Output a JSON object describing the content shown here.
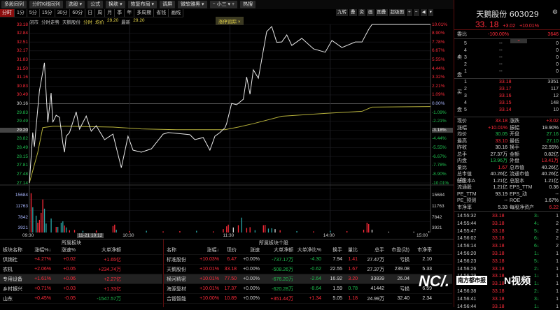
{
  "toolbar": {
    "buttons": [
      "多股同列",
      "分时K线同列",
      "选股 ▾",
      "公式",
      "换肤 ▾",
      "恢复布局 ▾",
      "调屏",
      "微软雅黑 ▾",
      "−  小三 ▾  +",
      "热搜"
    ]
  },
  "period_tabs": [
    "分时",
    "1分",
    "5分",
    "15分",
    "30分",
    "60分",
    "日",
    "周",
    "月",
    "季",
    "年",
    "多周期",
    "省钱",
    "画线"
  ],
  "chart_info": {
    "status": "闭市",
    "mode": "分时走势",
    "name": "天鹅股份",
    "type": "分时",
    "avg_label": "均价",
    "avg_value": "29.20",
    "last_label": "最新",
    "last_value": "29.20",
    "tag": "涨停追踪",
    "tag_close": "×",
    "right_tools": [
      "九转",
      "叠",
      "资",
      "画",
      "图叠",
      "超级图",
      "+",
      "−",
      "◀",
      "▾"
    ]
  },
  "chart_data": {
    "type": "line",
    "title": "天鹅股份 分时走势",
    "prev_close": 30.16,
    "left_ticks": [
      "33.18",
      "32.84",
      "32.51",
      "32.17",
      "31.83",
      "31.50",
      "31.16",
      "30.83",
      "30.49",
      "30.16",
      "29.83",
      "29.49",
      "29.20",
      "28.82",
      "28.49",
      "28.15",
      "27.81",
      "27.48",
      "27.14"
    ],
    "right_ticks": [
      "10.01%",
      "8.90%",
      "7.78%",
      "6.67%",
      "5.55%",
      "4.44%",
      "3.32%",
      "2.21%",
      "1.09%",
      "0.00%",
      "-1.09%",
      "-2.21%",
      "-3.18%",
      "-4.44%",
      "-5.55%",
      "-6.67%",
      "-7.78%",
      "-8.90%",
      "-10.01%"
    ],
    "highlight_index": 12,
    "ylim": [
      27.14,
      33.18
    ],
    "vol_ticks": [
      "15684",
      "11763",
      "7842",
      "3921"
    ],
    "vol_max": 15684,
    "time_ticks": [
      "09:30",
      "10:30",
      "11:30",
      "14:00",
      "15:00"
    ],
    "crosshair_time": "11-21 10:12",
    "price": [
      [
        0,
        27.14
      ],
      [
        2,
        29.06
      ],
      [
        3,
        28.52
      ],
      [
        4,
        29.27
      ],
      [
        6,
        30.65
      ],
      [
        9,
        31.72
      ],
      [
        11,
        29.45
      ],
      [
        13,
        30.57
      ],
      [
        14,
        29.45
      ],
      [
        16,
        29.72
      ],
      [
        18,
        29.64
      ],
      [
        20,
        28.66
      ],
      [
        21,
        28.31
      ],
      [
        22,
        28.92
      ],
      [
        24,
        29.06
      ],
      [
        28,
        29.85
      ],
      [
        30,
        29.19
      ],
      [
        34,
        29.69
      ],
      [
        37,
        29.11
      ],
      [
        40,
        29.32
      ],
      [
        45,
        28.79
      ],
      [
        50,
        29.0
      ],
      [
        55,
        27.72
      ],
      [
        57,
        28.31
      ],
      [
        59,
        28.92
      ],
      [
        62,
        28.39
      ],
      [
        67,
        28.31
      ],
      [
        73,
        28.44
      ],
      [
        80,
        29.0
      ],
      [
        83,
        29.06
      ],
      [
        96,
        28.98
      ],
      [
        99,
        28.79
      ],
      [
        104,
        28.87
      ],
      [
        108,
        28.39
      ],
      [
        111,
        28.92
      ],
      [
        114,
        29.06
      ],
      [
        117,
        29.24
      ],
      [
        118,
        29.4
      ],
      [
        121,
        30.17
      ],
      [
        124,
        30.12
      ],
      [
        128,
        30.33
      ],
      [
        130,
        31.18
      ],
      [
        132,
        30.52
      ],
      [
        134,
        31.45
      ],
      [
        137,
        31.13
      ],
      [
        142,
        32.91
      ],
      [
        145,
        33.1
      ],
      [
        148,
        32.5
      ],
      [
        151,
        32.51
      ],
      [
        154,
        32.78
      ],
      [
        157,
        32.38
      ],
      [
        163,
        32.65
      ],
      [
        170,
        32.25
      ],
      [
        177,
        32.12
      ],
      [
        181,
        32.57
      ],
      [
        187,
        32.3
      ],
      [
        195,
        32.51
      ],
      [
        199,
        32.51
      ],
      [
        203,
        32.99
      ],
      [
        205,
        33.18
      ],
      [
        240,
        33.18
      ]
    ],
    "avg": [
      [
        0,
        27.14
      ],
      [
        5,
        28.3
      ],
      [
        8,
        29.25
      ],
      [
        14,
        29.3
      ],
      [
        24,
        29.3
      ],
      [
        50,
        29.27
      ],
      [
        67,
        29.2
      ],
      [
        88,
        29.17
      ],
      [
        117,
        29.17
      ],
      [
        125,
        29.27
      ],
      [
        134,
        29.4
      ],
      [
        151,
        29.68
      ],
      [
        177,
        29.79
      ],
      [
        199,
        29.87
      ],
      [
        205,
        30.03
      ],
      [
        240,
        30.05
      ]
    ],
    "volume": [
      [
        1,
        14000,
        "r"
      ],
      [
        2,
        9000,
        "c"
      ],
      [
        4,
        6000,
        "c"
      ],
      [
        5,
        3500,
        "r"
      ],
      [
        6,
        4500,
        "r"
      ],
      [
        7,
        7000,
        "r"
      ],
      [
        8,
        11800,
        "r"
      ],
      [
        9,
        8500,
        "c"
      ],
      [
        10,
        3200,
        "c"
      ],
      [
        13,
        5000,
        "c"
      ],
      [
        16,
        2000,
        "r"
      ],
      [
        17,
        2000,
        "c"
      ],
      [
        19,
        3500,
        "c"
      ],
      [
        20,
        4000,
        "c"
      ],
      [
        21,
        2500,
        "r"
      ],
      [
        22,
        1800,
        "c"
      ],
      [
        24,
        800,
        "r"
      ],
      [
        27,
        900,
        "r"
      ],
      [
        32,
        600,
        "c"
      ],
      [
        40,
        700,
        "r"
      ],
      [
        50,
        2300,
        "r"
      ],
      [
        51,
        2800,
        "r"
      ],
      [
        52,
        1000,
        "c"
      ],
      [
        60,
        500,
        "r"
      ],
      [
        70,
        600,
        "c"
      ],
      [
        80,
        400,
        "r"
      ],
      [
        90,
        500,
        "r"
      ],
      [
        100,
        600,
        "c"
      ],
      [
        110,
        400,
        "r"
      ],
      [
        116,
        1200,
        "r"
      ],
      [
        118,
        2200,
        "r"
      ],
      [
        119,
        2800,
        "r"
      ],
      [
        122,
        1800,
        "w"
      ],
      [
        125,
        2600,
        "r"
      ],
      [
        127,
        5300,
        "c"
      ],
      [
        130,
        1600,
        "r"
      ],
      [
        132,
        1900,
        "r"
      ],
      [
        135,
        800,
        "c"
      ],
      [
        140,
        2600,
        "r"
      ],
      [
        141,
        2700,
        "r"
      ],
      [
        143,
        1400,
        "c"
      ],
      [
        145,
        1500,
        "c"
      ],
      [
        147,
        1200,
        "w"
      ],
      [
        150,
        800,
        "r"
      ],
      [
        160,
        500,
        "c"
      ],
      [
        170,
        400,
        "r"
      ],
      [
        180,
        600,
        "c"
      ],
      [
        190,
        500,
        "r"
      ],
      [
        200,
        1000,
        "r"
      ],
      [
        202,
        3500,
        "r"
      ],
      [
        203,
        3000,
        "r"
      ],
      [
        205,
        1000,
        "w"
      ],
      [
        215,
        300,
        "w"
      ],
      [
        230,
        300,
        "w"
      ],
      [
        239,
        400,
        "w"
      ]
    ]
  },
  "quote": {
    "title": "天鹅股份 603029",
    "price": "33. 18",
    "change": "+3.02",
    "pct": "+10.01%",
    "weibi_label": "委比",
    "weibi": "-100.00%",
    "weibi_diff": "3646",
    "sell_label": "卖盘",
    "buy_label": "买盘",
    "asks": [
      {
        "n": "5",
        "p": "--",
        "v": "0"
      },
      {
        "n": "4",
        "p": "--",
        "v": "0"
      },
      {
        "n": "3",
        "p": "--",
        "v": "0"
      },
      {
        "n": "2",
        "p": "--",
        "v": "0"
      },
      {
        "n": "1",
        "p": "--",
        "v": "0"
      }
    ],
    "bids": [
      {
        "n": "1",
        "p": "33.18",
        "v": "3351"
      },
      {
        "n": "2",
        "p": "33.17",
        "v": "117"
      },
      {
        "n": "3",
        "p": "33.16",
        "v": "12"
      },
      {
        "n": "4",
        "p": "33.15",
        "v": "148"
      },
      {
        "n": "5",
        "p": "33.14",
        "v": "10"
      }
    ],
    "stats": [
      [
        "现价",
        "33.18",
        "r",
        "涨跌",
        "+3.02",
        "r"
      ],
      [
        "涨幅",
        "+10.01%",
        "r",
        "振幅",
        "19.90%",
        "w"
      ],
      [
        "均价",
        "30.05",
        "g",
        "开盘",
        "27.16",
        "g"
      ],
      [
        "最高",
        "33.10",
        "r",
        "最低",
        "27.10",
        "g"
      ],
      [
        "昨收",
        "30.16",
        "w",
        "换手",
        "22.55%",
        "w"
      ],
      [
        "总手",
        "27.37万",
        "w",
        "金额",
        "0.82亿",
        "w"
      ],
      [
        "内盘",
        "13.96万",
        "g",
        "外盘",
        "13.41万",
        "r"
      ],
      [
        "量比",
        "1.67",
        "r",
        "总市值",
        "40.26亿",
        "w"
      ],
      [
        "总市值(合)",
        "40.26亿",
        "w",
        "流通市值",
        "40.26亿",
        "w"
      ],
      [
        "总股本A",
        "1.21亿",
        "w",
        "总股本",
        "1.21亿",
        "w"
      ],
      [
        "流通股",
        "1.21亿",
        "w",
        "EPS_TTM",
        "0.36",
        "w"
      ],
      [
        "PE_TTM",
        "93.19",
        "w",
        "EPS_动",
        "--",
        "w"
      ],
      [
        "PE_预测",
        "--",
        "w",
        "ROE",
        "1.67%",
        "w"
      ],
      [
        "市净率",
        "5.33",
        "w",
        "每股净资产",
        "6.22",
        "r"
      ]
    ],
    "ticks": [
      [
        "14:55:32",
        "33.18",
        "3",
        "1"
      ],
      [
        "14:55:44",
        "33.18",
        "4",
        "2"
      ],
      [
        "14:55:47",
        "33.18",
        "5",
        "2"
      ],
      [
        "14:56:02",
        "33.18",
        "6",
        "2"
      ],
      [
        "14:56:14",
        "33.18",
        "6",
        "2"
      ],
      [
        "14:56:20",
        "33.18",
        "1",
        "1"
      ],
      [
        "14:56:23",
        "33.18",
        "5",
        "1"
      ],
      [
        "14:56:26",
        "33.18",
        "2",
        "1"
      ],
      [
        "14:56:29",
        "33.18",
        "1",
        "1"
      ],
      [
        "14:56:32",
        "33.18",
        "1",
        "1"
      ],
      [
        "14:56:38",
        "33.18",
        "2",
        "1"
      ],
      [
        "14:56:41",
        "33.18",
        "3",
        "1"
      ],
      [
        "14:56:44",
        "33.18",
        "1",
        "1"
      ]
    ]
  },
  "sector": {
    "title": "所属板块",
    "headers": [
      "板块名称",
      "涨幅%↓",
      "涨速%",
      "大单净额"
    ],
    "rows": [
      [
        "供销社",
        "+4.27%",
        "+0.02",
        "+1.65亿"
      ],
      [
        "农机",
        "+2.06%",
        "+0.05",
        "+234.74万"
      ],
      [
        "专用设备",
        "+1.61%",
        "+0.06",
        "+2.27亿"
      ],
      [
        "乡村振兴",
        "+0.71%",
        "+0.03",
        "+1.33亿"
      ],
      [
        "山东",
        "+0.45%",
        "-0.05",
        "-1547.57万"
      ]
    ]
  },
  "stocks": {
    "title": "所属板块个股",
    "headers": [
      "名称",
      "涨幅↓",
      "现价",
      "涨速",
      "大单净额",
      "大单净比%",
      "换手",
      "量比",
      "总手",
      "市盈(动)",
      "市净率"
    ],
    "rows": [
      [
        "标准股份",
        "+10.03%",
        "6.47",
        "+0.00%",
        "-737.17万",
        "-4.30",
        "7.94",
        "1.41",
        "27.47万",
        "亏损",
        "2.10"
      ],
      [
        "天鹅股份",
        "+10.01%",
        "33.18",
        "+0.00%",
        "-508.26万",
        "-0.62",
        "22.55",
        "1.67",
        "27.37万",
        "239.08",
        "5.33"
      ],
      [
        "横河精密",
        "+10.01%",
        "77.50",
        "+0.00%",
        "-676.20万",
        "-2.64",
        "16.92",
        "3.20",
        "33839",
        "26.04",
        ""
      ],
      [
        "海源复材",
        "+10.01%",
        "17.37",
        "+0.00%",
        "-620.28万",
        "-8.64",
        "1.59",
        "0.78",
        "41442",
        "亏损",
        "6.59"
      ],
      [
        "合锻智能",
        "+10.00%",
        "10.89",
        "+0.00%",
        "+351.44万",
        "+1.34",
        "5.05",
        "1.18",
        "24.99万",
        "32.40",
        "2.34"
      ]
    ]
  },
  "watermark": {
    "logo1": "NC/.",
    "logo2": "南方都市报",
    "logo3": "N视频"
  }
}
